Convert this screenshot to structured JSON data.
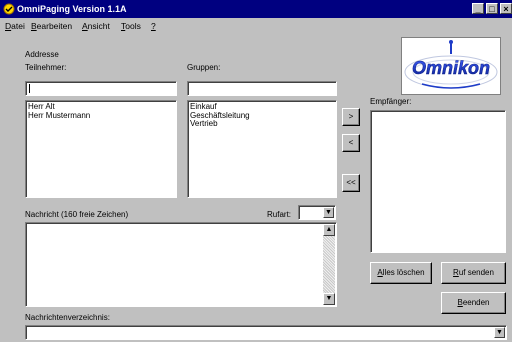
{
  "window": {
    "title": "OmniPaging Version 1.1A"
  },
  "menu": [
    "Datei",
    "Bearbeiten",
    "Ansicht",
    "Tools",
    "?"
  ],
  "menu_access_keys": [
    "D",
    "B",
    "A",
    "T",
    "?"
  ],
  "logo": {
    "text": "Omnikon"
  },
  "address": {
    "group_label": "Addresse",
    "participants_label": "Teilnehmer:",
    "participants_input": "",
    "participants": [
      "Herr Alt",
      "Herr Mustermann"
    ],
    "groups_label": "Gruppen:",
    "groups_input": "",
    "groups": [
      "Einkauf",
      "Geschäftsleitung",
      "Vertrieb"
    ]
  },
  "transfer": {
    "add": ">",
    "remove": "<",
    "remove_all": "<<"
  },
  "recipients": {
    "label": "Empfänger:",
    "items": []
  },
  "message": {
    "label": "Nachricht (160 freie Zeichen)",
    "text": "",
    "rufart_label": "Rufart:",
    "rufart_value": ""
  },
  "buttons": {
    "clear_all": "Alles löschen",
    "send": "Ruf senden",
    "exit": "Beenden"
  },
  "history": {
    "label": "Nachrichtenverzeichnis:",
    "value": ""
  },
  "colors": {
    "titlebar": "#000080",
    "face": "#c0c0c0",
    "logo_blue": "#1e3cc8"
  }
}
